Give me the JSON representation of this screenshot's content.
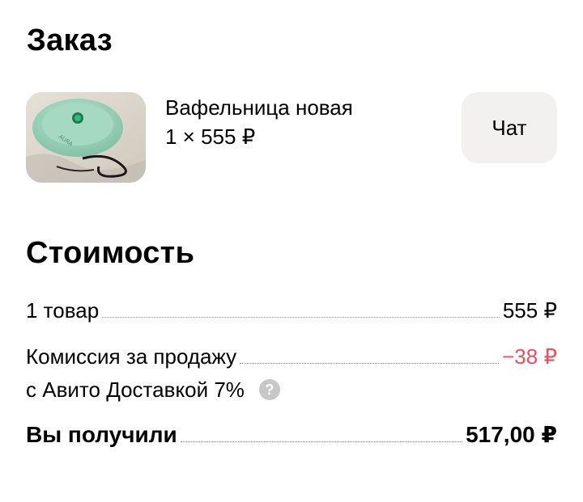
{
  "order": {
    "title": "Заказ",
    "product": {
      "image_alt": "product photo",
      "name": "Вафельница новая",
      "quantity_price": "1 × 555 ₽"
    },
    "chat_label": "Чат"
  },
  "cost": {
    "title": "Стоимость",
    "items_label": "1 товар",
    "items_value": "555 ₽",
    "commission_label_line1": "Комиссия за продажу",
    "commission_label_line2": "с Авито Доставкой 7%",
    "commission_value": "−38 ₽",
    "help_icon_glyph": "?",
    "total_label": "Вы получили",
    "total_value": "517,00 ₽"
  },
  "colors": {
    "negative": "#e8505b",
    "chat_bg": "#f2f1f0",
    "help_icon_bg": "#c7c7c7"
  },
  "icons": {
    "help": "question-circle-icon"
  }
}
